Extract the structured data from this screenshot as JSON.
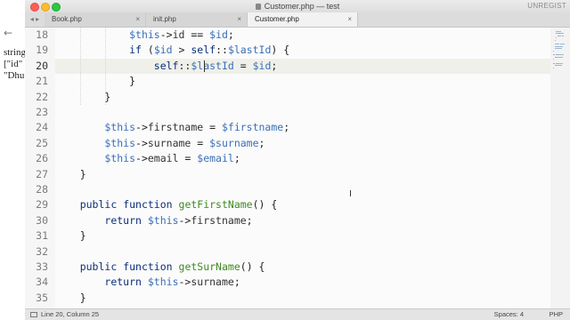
{
  "window": {
    "title": "Customer.php — test",
    "unregistered": "UNREGIST"
  },
  "background_window": {
    "back_glyph": "←",
    "lines": [
      "string",
      "[\"id\"",
      "\"Dhu"
    ]
  },
  "tabs": [
    {
      "label": "Book.php",
      "close": "×",
      "active": false
    },
    {
      "label": "init.php",
      "close": "×",
      "active": false
    },
    {
      "label": "Customer.php",
      "close": "×",
      "active": true
    }
  ],
  "tab_arrows": "◂ ▸",
  "editor": {
    "current_line": 20,
    "lines": [
      {
        "num": "18",
        "tokens": [
          {
            "t": "            ",
            "c": "op"
          },
          {
            "t": "$this",
            "c": "var"
          },
          {
            "t": "->",
            "c": "op"
          },
          {
            "t": "id",
            "c": "prop"
          },
          {
            "t": " == ",
            "c": "op"
          },
          {
            "t": "$id",
            "c": "var"
          },
          {
            "t": ";",
            "c": "op"
          }
        ]
      },
      {
        "num": "19",
        "tokens": [
          {
            "t": "            ",
            "c": "op"
          },
          {
            "t": "if",
            "c": "kw"
          },
          {
            "t": " (",
            "c": "op"
          },
          {
            "t": "$id",
            "c": "var"
          },
          {
            "t": " > ",
            "c": "op"
          },
          {
            "t": "self",
            "c": "kw"
          },
          {
            "t": "::",
            "c": "op"
          },
          {
            "t": "$lastId",
            "c": "var"
          },
          {
            "t": ") {",
            "c": "op"
          }
        ]
      },
      {
        "num": "20",
        "tokens": [
          {
            "t": "                ",
            "c": "op"
          },
          {
            "t": "self",
            "c": "kw"
          },
          {
            "t": "::",
            "c": "op"
          },
          {
            "t": "$lastId",
            "c": "var"
          },
          {
            "t": " = ",
            "c": "op"
          },
          {
            "t": "$id",
            "c": "var"
          },
          {
            "t": ";",
            "c": "op"
          }
        ]
      },
      {
        "num": "21",
        "tokens": [
          {
            "t": "            }",
            "c": "op"
          }
        ]
      },
      {
        "num": "22",
        "tokens": [
          {
            "t": "        }",
            "c": "op"
          }
        ]
      },
      {
        "num": "23",
        "tokens": []
      },
      {
        "num": "24",
        "tokens": [
          {
            "t": "        ",
            "c": "op"
          },
          {
            "t": "$this",
            "c": "var"
          },
          {
            "t": "->",
            "c": "op"
          },
          {
            "t": "firstname",
            "c": "prop"
          },
          {
            "t": " = ",
            "c": "op"
          },
          {
            "t": "$firstname",
            "c": "var"
          },
          {
            "t": ";",
            "c": "op"
          }
        ]
      },
      {
        "num": "25",
        "tokens": [
          {
            "t": "        ",
            "c": "op"
          },
          {
            "t": "$this",
            "c": "var"
          },
          {
            "t": "->",
            "c": "op"
          },
          {
            "t": "surname",
            "c": "prop"
          },
          {
            "t": " = ",
            "c": "op"
          },
          {
            "t": "$surname",
            "c": "var"
          },
          {
            "t": ";",
            "c": "op"
          }
        ]
      },
      {
        "num": "26",
        "tokens": [
          {
            "t": "        ",
            "c": "op"
          },
          {
            "t": "$this",
            "c": "var"
          },
          {
            "t": "->",
            "c": "op"
          },
          {
            "t": "email",
            "c": "prop"
          },
          {
            "t": " = ",
            "c": "op"
          },
          {
            "t": "$email",
            "c": "var"
          },
          {
            "t": ";",
            "c": "op"
          }
        ]
      },
      {
        "num": "27",
        "tokens": [
          {
            "t": "    }",
            "c": "op"
          }
        ]
      },
      {
        "num": "28",
        "tokens": []
      },
      {
        "num": "29",
        "tokens": [
          {
            "t": "    ",
            "c": "op"
          },
          {
            "t": "public",
            "c": "kw"
          },
          {
            "t": " ",
            "c": "op"
          },
          {
            "t": "function",
            "c": "kw"
          },
          {
            "t": " ",
            "c": "op"
          },
          {
            "t": "getFirstName",
            "c": "fn"
          },
          {
            "t": "() {",
            "c": "op"
          }
        ]
      },
      {
        "num": "30",
        "tokens": [
          {
            "t": "        ",
            "c": "op"
          },
          {
            "t": "return",
            "c": "kw"
          },
          {
            "t": " ",
            "c": "op"
          },
          {
            "t": "$this",
            "c": "var"
          },
          {
            "t": "->",
            "c": "op"
          },
          {
            "t": "firstname",
            "c": "prop"
          },
          {
            "t": ";",
            "c": "op"
          }
        ]
      },
      {
        "num": "31",
        "tokens": [
          {
            "t": "    }",
            "c": "op"
          }
        ]
      },
      {
        "num": "32",
        "tokens": []
      },
      {
        "num": "33",
        "tokens": [
          {
            "t": "    ",
            "c": "op"
          },
          {
            "t": "public",
            "c": "kw"
          },
          {
            "t": " ",
            "c": "op"
          },
          {
            "t": "function",
            "c": "kw"
          },
          {
            "t": " ",
            "c": "op"
          },
          {
            "t": "getSurName",
            "c": "fn"
          },
          {
            "t": "() {",
            "c": "op"
          }
        ]
      },
      {
        "num": "34",
        "tokens": [
          {
            "t": "        ",
            "c": "op"
          },
          {
            "t": "return",
            "c": "kw"
          },
          {
            "t": " ",
            "c": "op"
          },
          {
            "t": "$this",
            "c": "var"
          },
          {
            "t": "->",
            "c": "op"
          },
          {
            "t": "surname",
            "c": "prop"
          },
          {
            "t": ";",
            "c": "op"
          }
        ]
      },
      {
        "num": "35",
        "tokens": [
          {
            "t": "    }",
            "c": "op"
          }
        ]
      }
    ]
  },
  "statusbar": {
    "position": "Line 20, Column 25",
    "spaces": "Spaces: 4",
    "syntax": "PHP"
  },
  "colors": {
    "keyword": "#0b2f7a",
    "variable": "#3a6fb6",
    "function": "#3f8a1f"
  }
}
